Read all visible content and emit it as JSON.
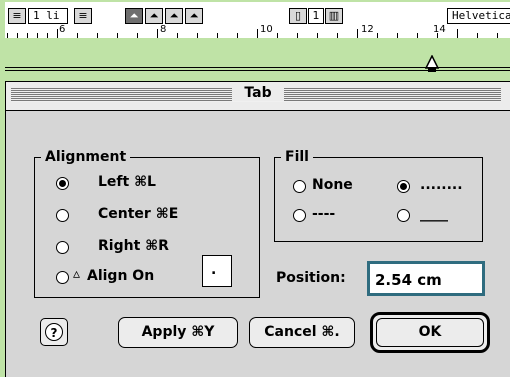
{
  "toolbar": {
    "line_spacing": "1 li",
    "columns": "1",
    "font": "Helvetica"
  },
  "ruler": {
    "numbers": [
      "6",
      "8",
      "10",
      "12",
      "14"
    ]
  },
  "dialog": {
    "title": "Tab",
    "alignment": {
      "label": "Alignment",
      "options": [
        "Left ⌘L",
        "Center ⌘E",
        "Right ⌘R",
        "Align On"
      ],
      "selected": "Left ⌘L",
      "align_on_char": "."
    },
    "fill": {
      "label": "Fill",
      "options": [
        "None",
        "........",
        "----",
        "____"
      ],
      "selected": "........"
    },
    "position": {
      "label": "Position:",
      "value": "2.54 cm"
    },
    "buttons": {
      "help": "?",
      "apply": "Apply ⌘Y",
      "cancel": "Cancel ⌘.",
      "ok": "OK"
    }
  }
}
